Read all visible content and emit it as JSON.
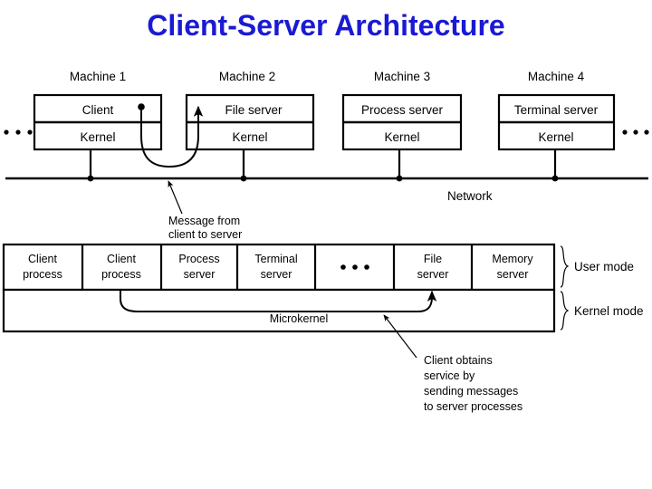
{
  "slide": {
    "title": "Client-Server Architecture",
    "title_color": "#1a1ad4",
    "background_color": "#ffffff"
  },
  "upper_diagram": {
    "machines": [
      {
        "caption": "Machine 1",
        "top_label": "Client",
        "bottom_label": "Kernel"
      },
      {
        "caption": "Machine 2",
        "top_label": "File server",
        "bottom_label": "Kernel"
      },
      {
        "caption": "Machine 3",
        "top_label": "Process server",
        "bottom_label": "Kernel"
      },
      {
        "caption": "Machine 4",
        "top_label": "Terminal server",
        "bottom_label": "Kernel"
      }
    ],
    "left_ellipsis": "• • •",
    "right_ellipsis": "• • •",
    "network_label": "Network",
    "annotation": {
      "line1": "Message from",
      "line2": "client to server"
    }
  },
  "lower_diagram": {
    "user_cells": [
      {
        "line1": "Client",
        "line2": "process"
      },
      {
        "line1": "Client",
        "line2": "process"
      },
      {
        "line1": "Process",
        "line2": "server"
      },
      {
        "line1": "Terminal",
        "line2": "server"
      },
      {
        "line1": "• • •",
        "line2": ""
      },
      {
        "line1": "File",
        "line2": "server"
      },
      {
        "line1": "Memory",
        "line2": "server"
      }
    ],
    "kernel_label": "Microkernel",
    "mode_braces": [
      {
        "label": "User mode"
      },
      {
        "label": "Kernel mode"
      }
    ],
    "annotation": {
      "line1": "Client obtains",
      "line2": "service by",
      "line3": "sending messages",
      "line4": "to server processes"
    }
  }
}
